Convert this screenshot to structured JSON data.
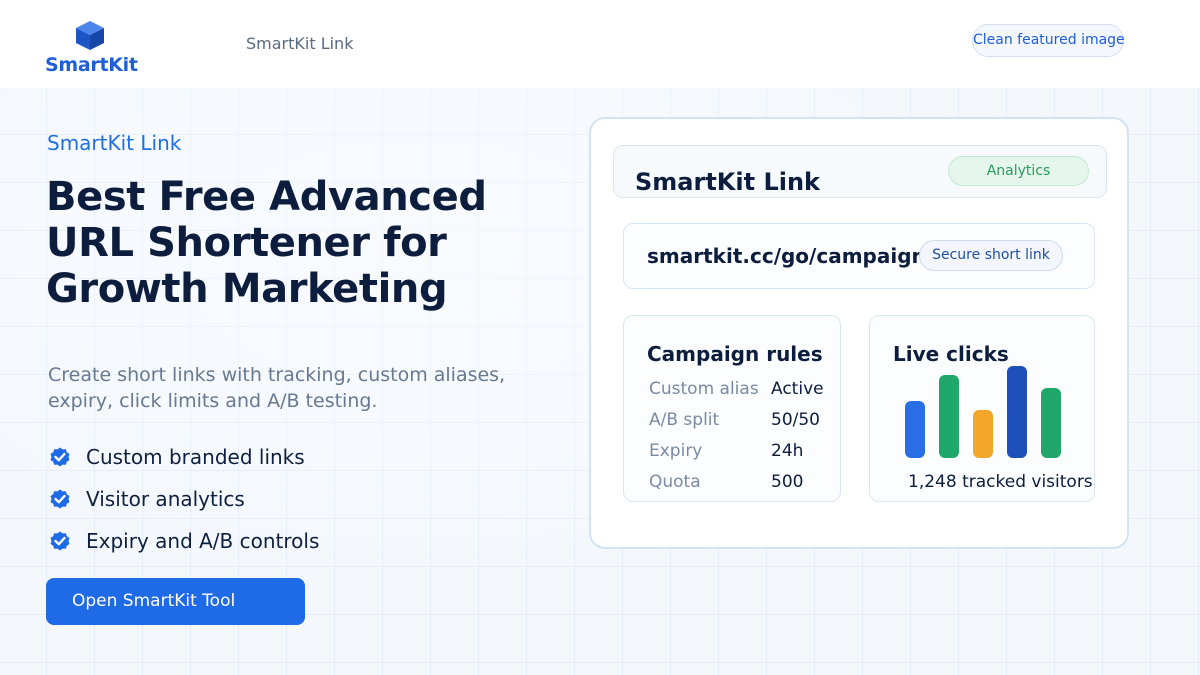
{
  "header": {
    "logo_text": "SmartKit",
    "nav_label": "SmartKit Link",
    "action_button": "Clean featured image"
  },
  "hero": {
    "eyebrow": "SmartKit Link",
    "headline": "Best Free Advanced URL Shortener for Growth Marketing",
    "subtitle": "Create short links with tracking, custom aliases, expiry, click limits and A/B testing.",
    "features": [
      "Custom branded links",
      "Visitor analytics",
      "Expiry and A/B controls"
    ],
    "cta_label": "Open SmartKit Tool"
  },
  "card": {
    "title": "SmartKit Link",
    "badge": "Analytics",
    "short_url": "smartkit.cc/go/campaign",
    "url_badge": "Secure short link",
    "rules": {
      "title": "Campaign rules",
      "rows": [
        {
          "key": "Custom alias",
          "value": "Active"
        },
        {
          "key": "A/B split",
          "value": "50/50"
        },
        {
          "key": "Expiry",
          "value": "24h"
        },
        {
          "key": "Quota",
          "value": "500"
        }
      ]
    },
    "clicks": {
      "title": "Live clicks",
      "caption": "1,248 tracked visitors",
      "bars": [
        {
          "level": 0.62,
          "color": "#2a6ee6"
        },
        {
          "level": 0.9,
          "color": "#1fa86a"
        },
        {
          "level": 0.52,
          "color": "#f2a62a"
        },
        {
          "level": 1.0,
          "color": "#1f4fb8"
        },
        {
          "level": 0.76,
          "color": "#1fa86a"
        }
      ]
    }
  },
  "colors": {
    "brand": "#1f5ed6",
    "accent": "#1f6ae6",
    "success": "#2c9a5e"
  }
}
